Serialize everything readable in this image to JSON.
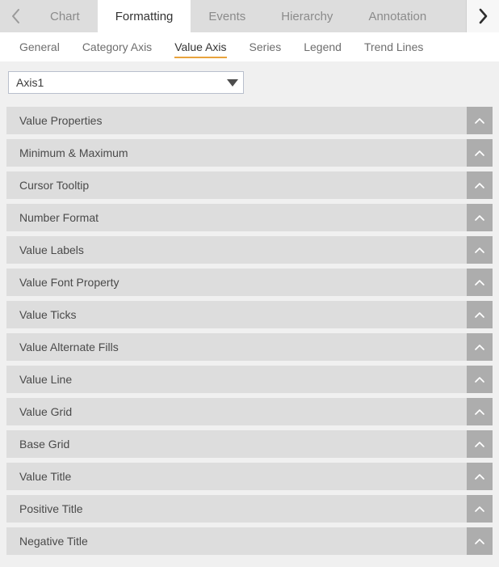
{
  "tabstrip": {
    "prev_icon": "chevron-left-icon",
    "next_icon": "chevron-right-icon",
    "tabs": [
      {
        "label": "Chart",
        "active": false
      },
      {
        "label": "Formatting",
        "active": true
      },
      {
        "label": "Events",
        "active": false
      },
      {
        "label": "Hierarchy",
        "active": false
      },
      {
        "label": "Annotation",
        "active": false
      }
    ]
  },
  "subtabs": {
    "items": [
      {
        "label": "General",
        "active": false
      },
      {
        "label": "Category Axis",
        "active": false
      },
      {
        "label": "Value Axis",
        "active": true
      },
      {
        "label": "Series",
        "active": false
      },
      {
        "label": "Legend",
        "active": false
      },
      {
        "label": "Trend Lines",
        "active": false
      }
    ],
    "active_underline_color": "#e8a33d"
  },
  "axis_select": {
    "value": "Axis1",
    "caret_icon": "caret-down-icon"
  },
  "accordion": {
    "toggle_icon": "chevron-up-icon",
    "sections": [
      {
        "label": "Value Properties"
      },
      {
        "label": "Minimum & Maximum"
      },
      {
        "label": "Cursor Tooltip"
      },
      {
        "label": "Number Format"
      },
      {
        "label": "Value Labels"
      },
      {
        "label": "Value Font Property"
      },
      {
        "label": "Value Ticks"
      },
      {
        "label": "Value Alternate Fills"
      },
      {
        "label": "Value Line"
      },
      {
        "label": "Value Grid"
      },
      {
        "label": "Base Grid"
      },
      {
        "label": "Value Title"
      },
      {
        "label": "Positive Title"
      },
      {
        "label": "Negative Title"
      }
    ]
  },
  "colors": {
    "page_background": "#f0f0f0",
    "row_fill": "#dddddd",
    "toggle_fill": "#adadad",
    "accent": "#e8a33d"
  }
}
